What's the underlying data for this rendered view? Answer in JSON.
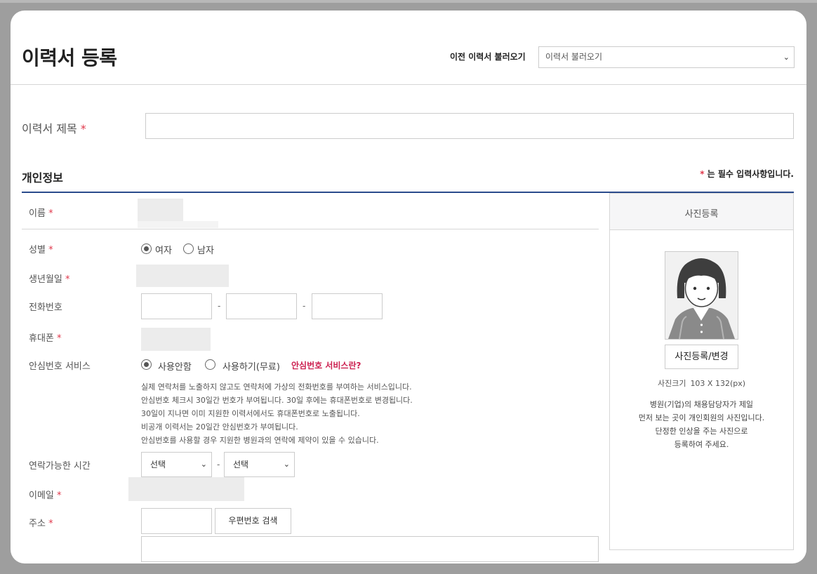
{
  "header": {
    "title": "이력서 등록",
    "load_label": "이전 이력서 불러오기",
    "load_select_value": "이력서 불러오기"
  },
  "resume_title": {
    "label": "이력서 제목",
    "required_mark": "*"
  },
  "section": {
    "title": "개인정보",
    "required_note_mark": "*",
    "required_note_text": "는 필수 입력사항입니다."
  },
  "fields": {
    "name": {
      "label": "이름",
      "required": "*"
    },
    "gender": {
      "label": "성별",
      "required": "*",
      "options": [
        "여자",
        "남자"
      ],
      "selected": "여자"
    },
    "birth": {
      "label": "생년월일",
      "required": "*"
    },
    "phone": {
      "label": "전화번호",
      "sep": "-"
    },
    "mobile": {
      "label": "휴대폰",
      "required": "*"
    },
    "safe_number": {
      "label": "안심번호 서비스",
      "options": [
        "사용안함",
        "사용하기(무료)"
      ],
      "selected": "사용안함",
      "help_link": "안심번호 서비스란?",
      "desc": [
        "실제 연락처를 노출하지 않고도 연락처에 가상의 전화번호를 부여하는 서비스입니다.",
        "안심번호 체크시 30일간 번호가 부여됩니다. 30일 후에는 휴대폰번호로 변경됩니다.",
        "30일이 지나면 이미 지원한 이력서에서도 휴대폰번호로 노출됩니다.",
        "비공개 이력서는 20일간 안심번호가 부여됩니다.",
        "안심번호를 사용할 경우 지원한 병원과의 연락에 제약이 있을 수 있습니다."
      ]
    },
    "contact_time": {
      "label": "연락가능한 시간",
      "from": "선택",
      "to": "선택",
      "sep": "-"
    },
    "email": {
      "label": "이메일",
      "required": "*"
    },
    "address": {
      "label": "주소",
      "required": "*",
      "zip_button": "우편번호 검색"
    }
  },
  "photo": {
    "title": "사진등록",
    "button": "사진등록/변경",
    "size_label": "사진크기",
    "size_value": "103 X 132(px)",
    "notes": [
      "병원(기업)의 채용담당자가 제일",
      "먼저 보는 곳이 개인회원의 사진입니다.",
      "단정한 인상을 주는 사진으로",
      "등록하여 주세요."
    ]
  },
  "colors": {
    "accent": "#2a4b8c",
    "required": "#e0384b",
    "link": "#cc1f4f"
  }
}
